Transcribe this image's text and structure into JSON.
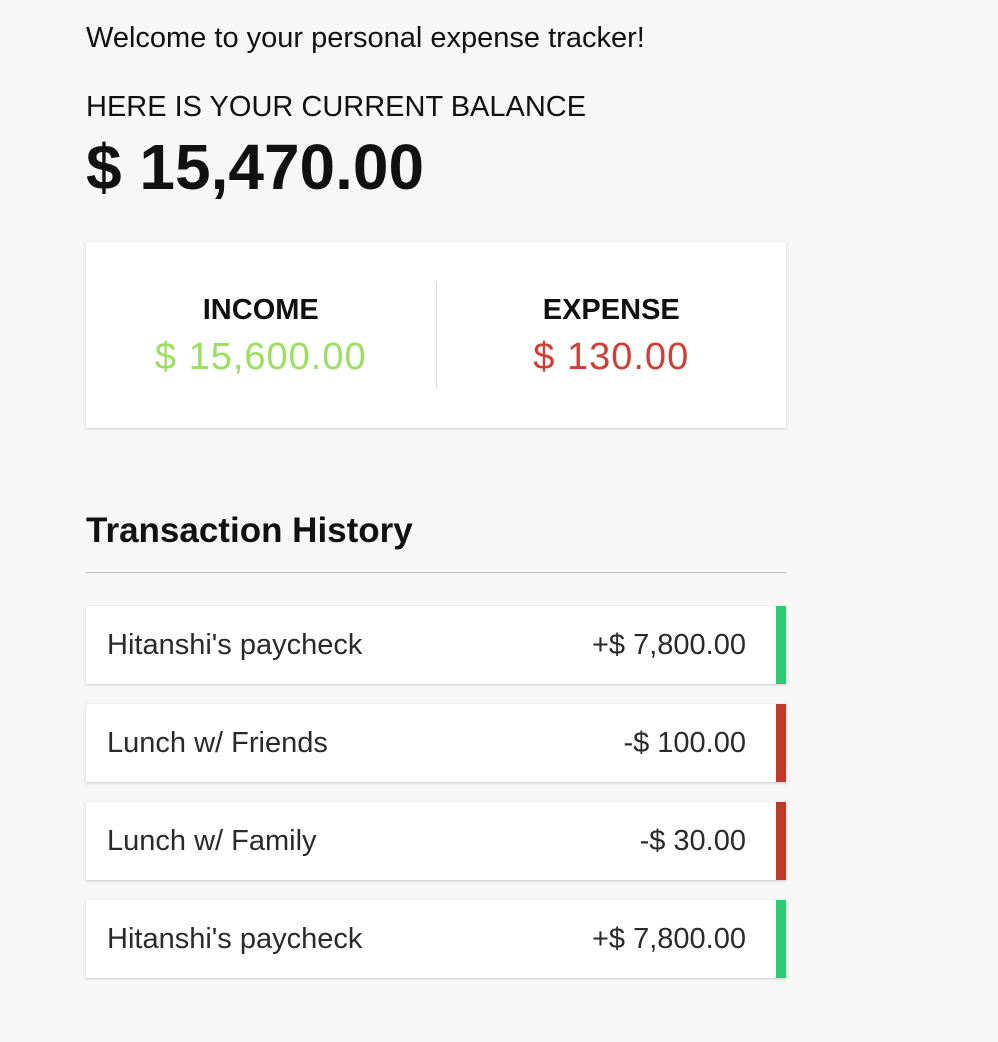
{
  "header": {
    "welcome": "Welcome to your personal expense tracker!",
    "balance_label": "HERE IS YOUR CURRENT BALANCE",
    "balance_value": "$ 15,470.00"
  },
  "summary": {
    "income_label": "INCOME",
    "income_value": "$ 15,600.00",
    "expense_label": "EXPENSE",
    "expense_value": "$ 130.00"
  },
  "history": {
    "title": "Transaction History",
    "items": [
      {
        "name": "Hitanshi's paycheck",
        "amount": "+$ 7,800.00",
        "type": "plus"
      },
      {
        "name": "Lunch w/ Friends",
        "amount": "-$ 100.00",
        "type": "minus"
      },
      {
        "name": "Lunch w/ Family",
        "amount": "-$ 30.00",
        "type": "minus"
      },
      {
        "name": "Hitanshi's paycheck",
        "amount": "+$ 7,800.00",
        "type": "plus"
      }
    ]
  },
  "colors": {
    "income": "#9adf5f",
    "expense": "#cf3f35",
    "plus_bar": "#2ecc71",
    "minus_bar": "#c0392b"
  }
}
